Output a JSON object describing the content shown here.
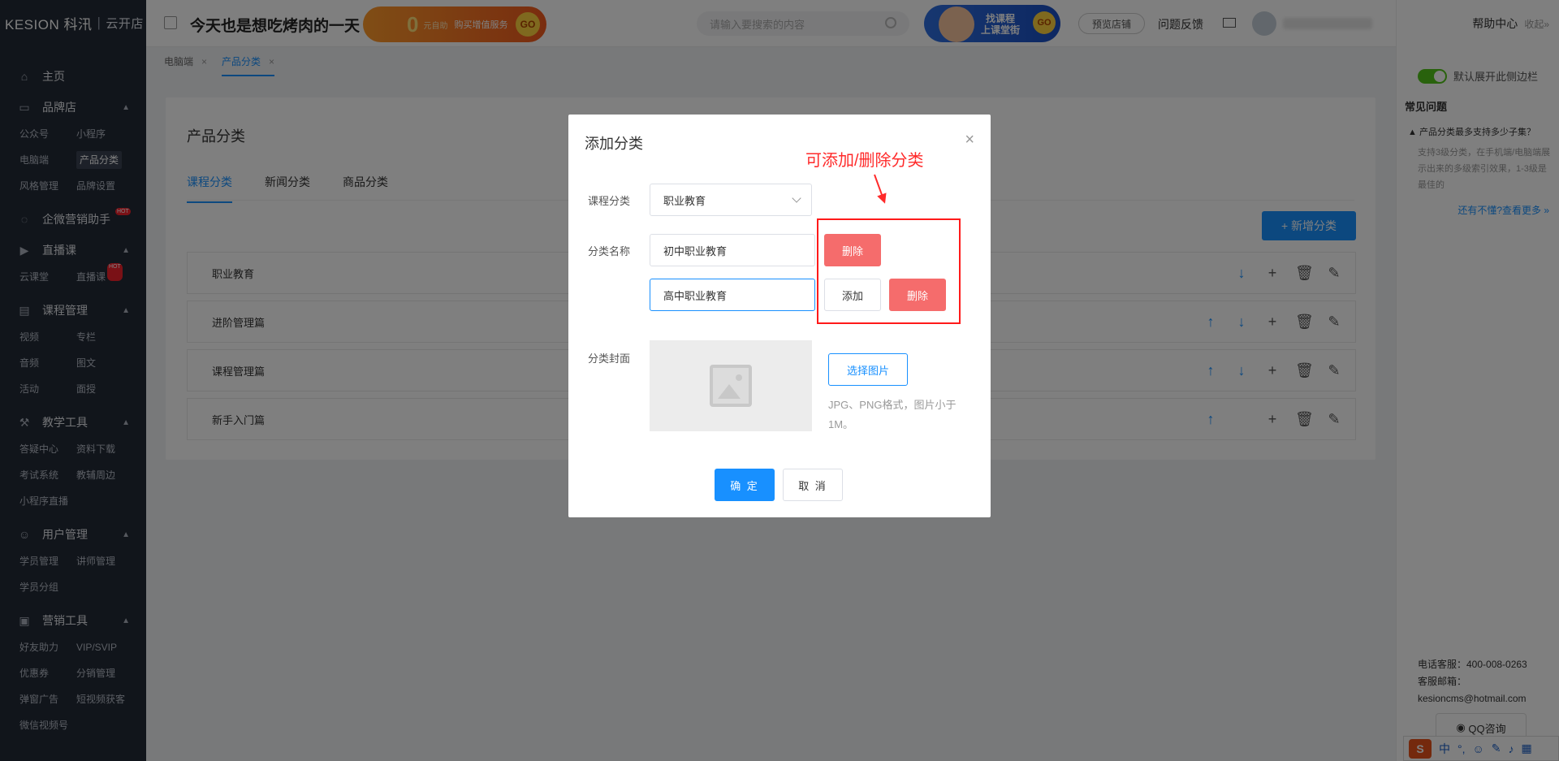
{
  "sidebar": {
    "logo_brand": "KESION 科汛",
    "logo_sub": "云开店",
    "home": "主页",
    "groups": [
      {
        "title": "品牌店",
        "items": [
          "公众号",
          "小程序",
          "电脑端",
          "产品分类",
          "风格管理",
          "品牌设置"
        ]
      },
      {
        "title": "企微营销助手",
        "hot": "HOT",
        "items": []
      },
      {
        "title": "直播课",
        "items": [
          "云课堂",
          "直播课"
        ]
      },
      {
        "title": "课程管理",
        "items": [
          "视频",
          "专栏",
          "音频",
          "图文",
          "活动",
          "面授"
        ]
      },
      {
        "title": "教学工具",
        "items": [
          "答疑中心",
          "资料下载",
          "考试系统",
          "教辅周边",
          "小程序直播"
        ]
      },
      {
        "title": "用户管理",
        "items": [
          "学员管理",
          "讲师管理",
          "学员分组"
        ]
      },
      {
        "title": "营销工具",
        "items": [
          "好友助力",
          "VIP/SVIP",
          "优惠券",
          "分销管理",
          "弹窗广告",
          "短视频获客",
          "微信视频号"
        ]
      }
    ],
    "hot_label": "HOT"
  },
  "header": {
    "title": "今天也是想吃烤肉的一天",
    "promo_zero": "0",
    "promo_t1": "元自助",
    "promo_t2": "购买增值服务",
    "promo_go": "GO",
    "search_placeholder": "请输入要搜索的内容",
    "banner2_line1": "找课程",
    "banner2_line2": "上课堂街",
    "banner2_go": "GO",
    "preview_store": "预览店铺",
    "feedback": "问题反馈"
  },
  "right_panel": {
    "help_center": "帮助中心",
    "collapse": "收起»",
    "toggle_label": "默认展开此侧边栏",
    "faq_title": "常见问题",
    "faq_q": "产品分类最多支持多少子集？",
    "faq_a": "支持3级分类，在手机端/电脑端展示出来的多级索引效果，1-3级是最佳的",
    "more": "还有不懂?查看更多 »",
    "phone": "电话客服：400-008-0263",
    "email": "客服邮箱：kesioncms@hotmail.com",
    "qq": "QQ咨询"
  },
  "ime": {
    "logo": "S",
    "lang": "中"
  },
  "tabs": [
    {
      "label": "电脑端",
      "close": "×"
    },
    {
      "label": "产品分类",
      "close": "×"
    }
  ],
  "main": {
    "title": "产品分类",
    "tabs": [
      "课程分类",
      "新闻分类",
      "商品分类"
    ],
    "new_button": "+ 新增分类",
    "rows": [
      {
        "name": "职业教育"
      },
      {
        "name": "进阶管理篇"
      },
      {
        "name": "课程管理篇"
      },
      {
        "name": "新手入门篇"
      }
    ]
  },
  "modal": {
    "title": "添加分类",
    "close": "×",
    "label_course_cat": "课程分类",
    "select_value": "职业教育",
    "label_name": "分类名称",
    "input1_value": "初中职业教育",
    "input2_value": "高中职业教育",
    "delete_label": "删除",
    "add_label": "添加",
    "annotation": "可添加/删除分类",
    "label_cover": "分类封面",
    "pick_image": "选择图片",
    "pick_hint": "JPG、PNG格式，图片小于1M。",
    "ok": "确 定",
    "cancel": "取 消"
  },
  "colors": {
    "primary": "#1890ff",
    "danger": "#f56c6c",
    "sidebar_bg": "#232a36",
    "annotation_red": "#ff2a2a"
  }
}
